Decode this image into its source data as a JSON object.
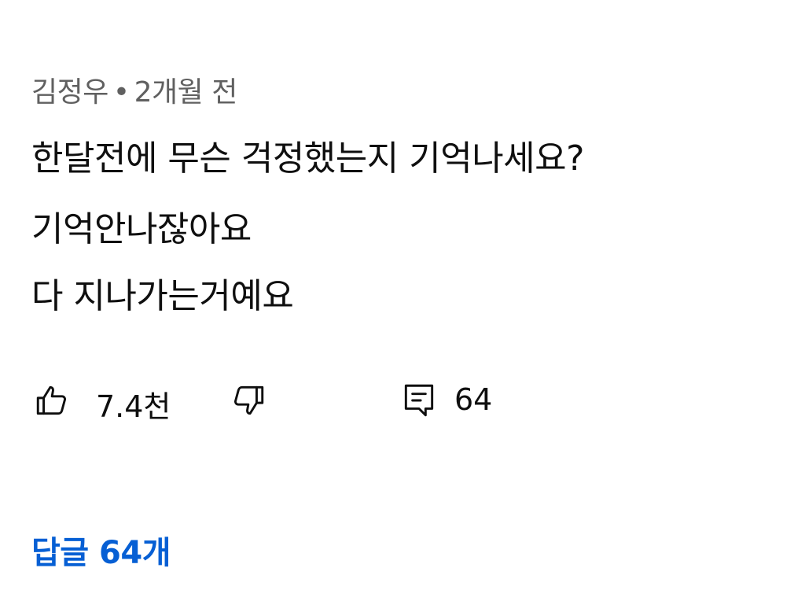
{
  "comment": {
    "author": "김정우",
    "separator": "•",
    "time": "2개월 전",
    "lines": [
      "한달전에 무슨 걱정했는지 기억나세요?",
      "기억안나잖아요",
      "다 지나가는거예요"
    ],
    "like_count": "7.4천",
    "reply_count": "64",
    "replies_link": "답글 64개"
  },
  "icons": {
    "like": "thumbs-up-icon",
    "dislike": "thumbs-down-icon",
    "reply": "comment-icon"
  },
  "colors": {
    "text": "#0f0f0f",
    "meta": "#606060",
    "link": "#065fd4"
  }
}
